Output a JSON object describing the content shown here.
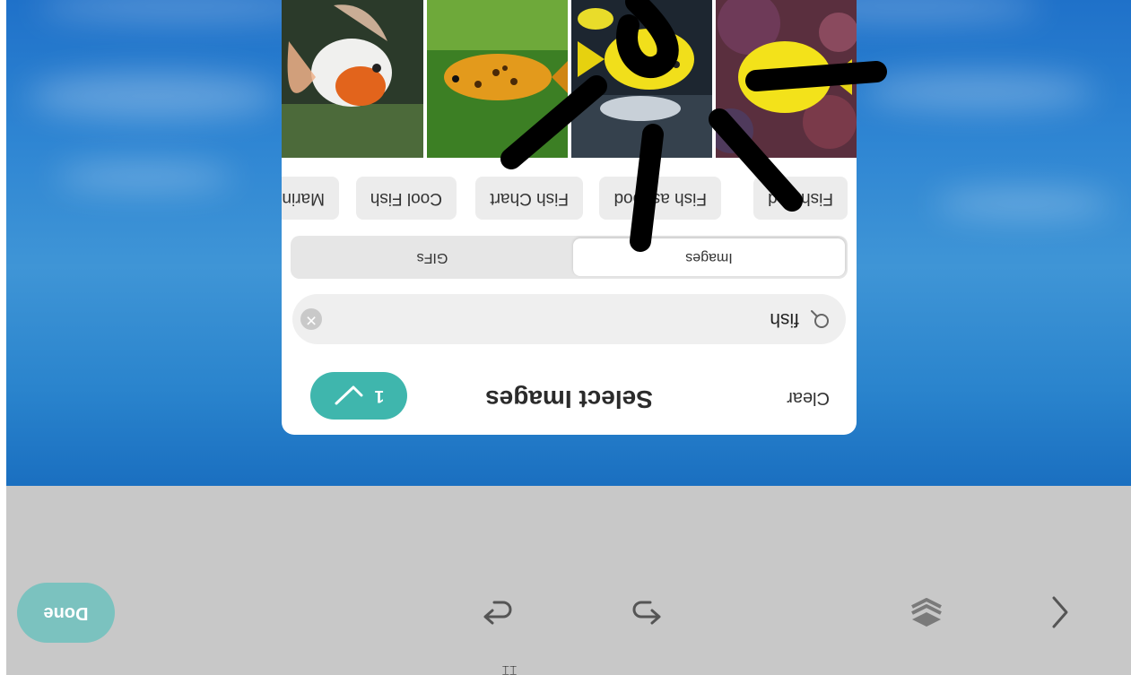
{
  "toolbar": {
    "done_label": "Done",
    "icons": [
      "chevron-left-icon",
      "layers-icon",
      "undo-icon",
      "redo-icon"
    ]
  },
  "picker": {
    "clear_label": "Clear",
    "title": "Select Images",
    "selected_count": "1",
    "search": {
      "value": "fish"
    },
    "tabs": [
      {
        "label": "Images",
        "active": true
      },
      {
        "label": "GIFs",
        "active": false
      }
    ],
    "chips": [
      "Fish and",
      "Fish as food",
      "Fish Chart",
      "Cool Fish",
      "Marin"
    ],
    "thumbnails": [
      "yellow-tang-on-reef",
      "yellow-fish-with-silver-fish",
      "spotted-orange-fish",
      "orange-white-goldfish"
    ]
  },
  "colors": {
    "accent": "#3fb6ad",
    "done_button": "#7bc2bf",
    "canvas_sky": "#2f86d3",
    "toolbar_bg": "#c8c8c8"
  }
}
